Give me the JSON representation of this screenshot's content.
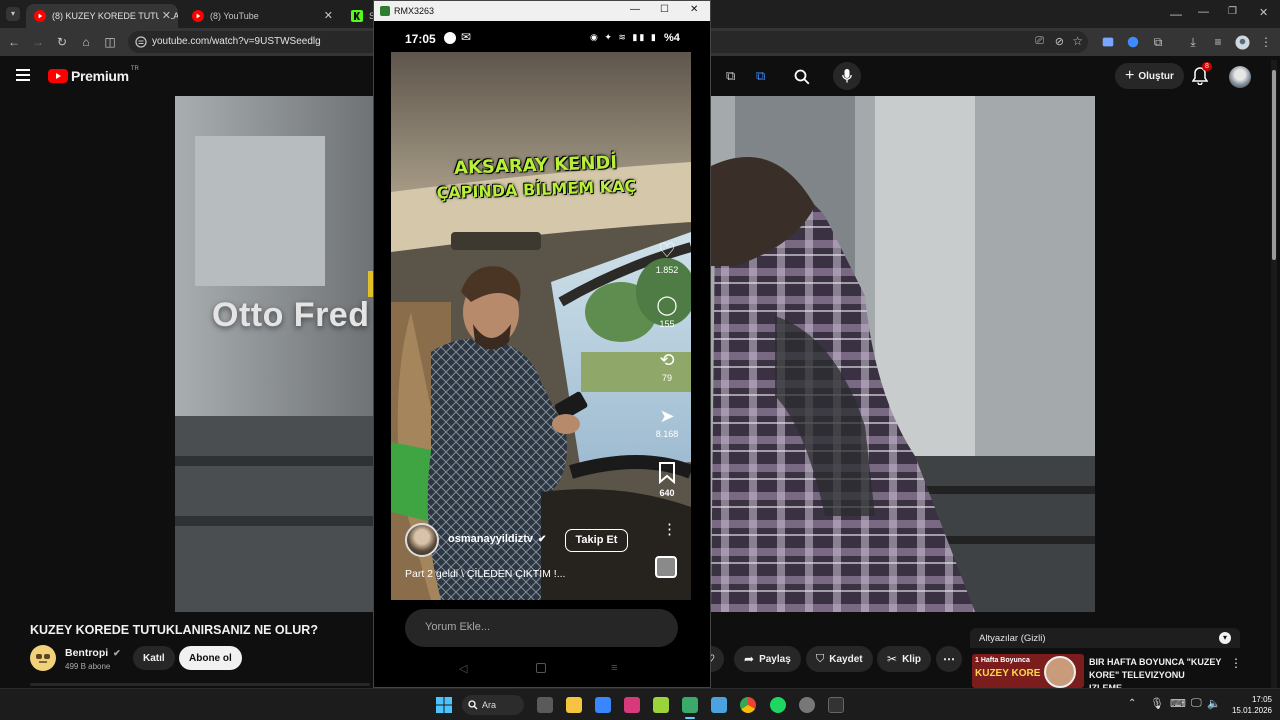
{
  "browser": {
    "tabs": [
      {
        "label": "(8) KUZEY KOREDE TUTUKLANI",
        "active": true
      },
      {
        "label": "(8) YouTube",
        "active": false
      },
      {
        "label": "St",
        "active": false
      }
    ],
    "url": "youtube.com/watch?v=9USTWSeedlg"
  },
  "youtube": {
    "logo_text": "Premium",
    "logo_sup": "TR",
    "create_label": "Oluştur",
    "notif_count": "8",
    "overlay_text": "Otto Fred",
    "video_title": "KUZEY KOREDE TUTUKLANIRSANIZ NE OLUR?",
    "channel_name": "Bentropi",
    "subscribers": "499 B abone",
    "join_label": "Katıl",
    "subscribe_label": "Abone ol",
    "share_label": "Paylaş",
    "save_label": "Kaydet",
    "clip_label": "Klip",
    "side_header": "Altyazılar (Gizli)",
    "side_video_title": "BIR HAFTA BOYUNCA \"KUZEY KORE\" TELEVIZYONU IZLEME...",
    "side_thumb_line1": "1 Hafta Boyunca",
    "side_thumb_line2": "KUZEY KORE"
  },
  "mirror": {
    "window_title": "RMX3263",
    "status_time": "17:05",
    "battery": "%4",
    "caption_line1": "AKSARAY KENDİ",
    "caption_line2": "ÇAPINDA BİLMEM KAÇ",
    "likes": "1.852",
    "comments": "155",
    "reposts": "79",
    "shares": "8.168",
    "saves": "640",
    "username": "osmanayyildiztv",
    "follow_label": "Takip Et",
    "description": "Part 2 geldi \\ ÇİLEDEN ÇIKTIM !...",
    "comment_placeholder": "Yorum Ekle..."
  },
  "taskbar": {
    "search_label": "Ara",
    "clock_time": "17:05",
    "clock_date": "15.01.2026"
  },
  "colors": {
    "youtube_red": "#ff0000",
    "caption_green": "#b8ef3a",
    "chrome_tab_active": "#353535",
    "taskbar": "#1c1c1c"
  }
}
